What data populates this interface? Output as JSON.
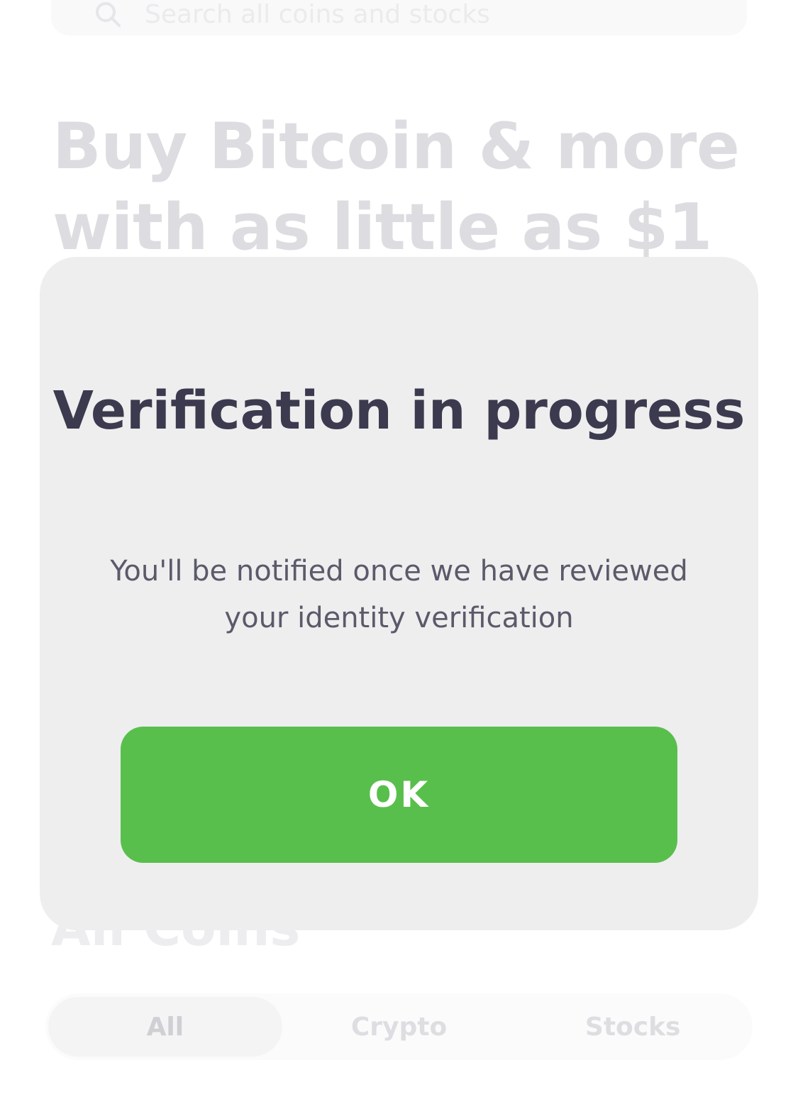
{
  "background": {
    "search": {
      "placeholder": "Search all coins and stocks",
      "icon": "search-icon"
    },
    "hero_title": "Buy Bitcoin & more with as little as $1",
    "section_title": "All Coins",
    "filter_tabs": [
      {
        "label": "All",
        "active": true
      },
      {
        "label": "Crypto",
        "active": false
      },
      {
        "label": "Stocks",
        "active": false
      }
    ]
  },
  "modal": {
    "title": "Verification in progress",
    "body": "You'll be notified once we have reviewed your identity verification",
    "ok_label": "OK"
  },
  "colors": {
    "accent_green": "#59bf4c",
    "modal_bg": "#eeeeef",
    "title_text": "#3b3a4e",
    "body_text": "#5b5a6a"
  }
}
